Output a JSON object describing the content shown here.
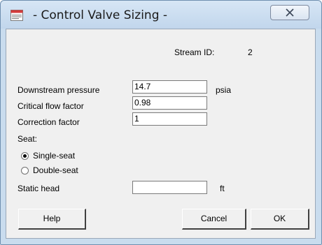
{
  "window": {
    "title": "- Control Valve Sizing -",
    "app_icon": "document-app-icon",
    "close_icon": "close-x-icon"
  },
  "stream": {
    "label": "Stream ID:",
    "value": "2"
  },
  "fields": [
    {
      "label": "Downstream pressure",
      "value": "14.7",
      "unit": "psia"
    },
    {
      "label": "Critical flow factor",
      "value": "0.98",
      "unit": ""
    },
    {
      "label": "Correction factor",
      "value": "1",
      "unit": ""
    }
  ],
  "seat": {
    "label": "Seat:",
    "options": [
      {
        "label": "Single-seat",
        "selected": true
      },
      {
        "label": "Double-seat",
        "selected": false
      }
    ]
  },
  "static_head": {
    "label": "Static head",
    "value": "",
    "unit": "ft"
  },
  "buttons": {
    "help": "Help",
    "cancel": "Cancel",
    "ok": "OK"
  }
}
